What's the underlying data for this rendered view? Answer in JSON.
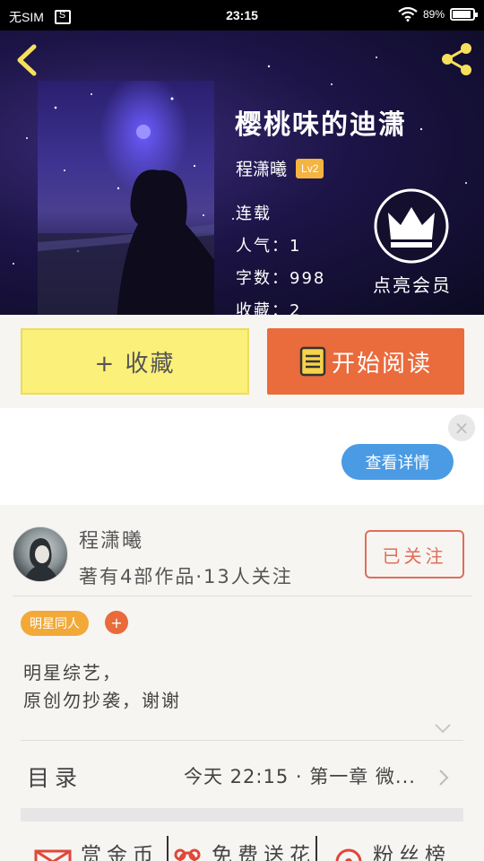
{
  "status_bar": {
    "carrier": "无SIM",
    "time": "23:15",
    "battery": "89%"
  },
  "book": {
    "title": "樱桃味的迪潇",
    "author": "程潇曦",
    "level": "Lv2",
    "status": "连载",
    "popularity": "人气：1",
    "word_count": "字数：998",
    "favorites": "收藏：2"
  },
  "vip": {
    "label": "点亮会员"
  },
  "actions": {
    "collect_label": "+ 收藏",
    "read_label": "开始阅读"
  },
  "ad": {
    "close_label": "×",
    "detail_label": "查看详情"
  },
  "author_card": {
    "name": "程潇曦",
    "stats": "著有4部作品·13人关注",
    "follow_label": "已关注",
    "tag": "明星同人",
    "tag_add": "+",
    "description_line1": "明星综艺，",
    "description_line2": "原创勿抄袭，谢谢"
  },
  "toc": {
    "label": "目录",
    "latest": "今天 22:15 · 第一章 微..."
  },
  "bottom_tabs": {
    "reward": "赏金币",
    "flowers": "免费送花",
    "fans": "粉丝榜"
  },
  "colors": {
    "collect_bg": "#fbf07a",
    "read_bg": "#ea6b3c",
    "detail_bg": "#4a9be3",
    "level_badge": "#f3b442",
    "follow_border": "#e06e5a"
  }
}
